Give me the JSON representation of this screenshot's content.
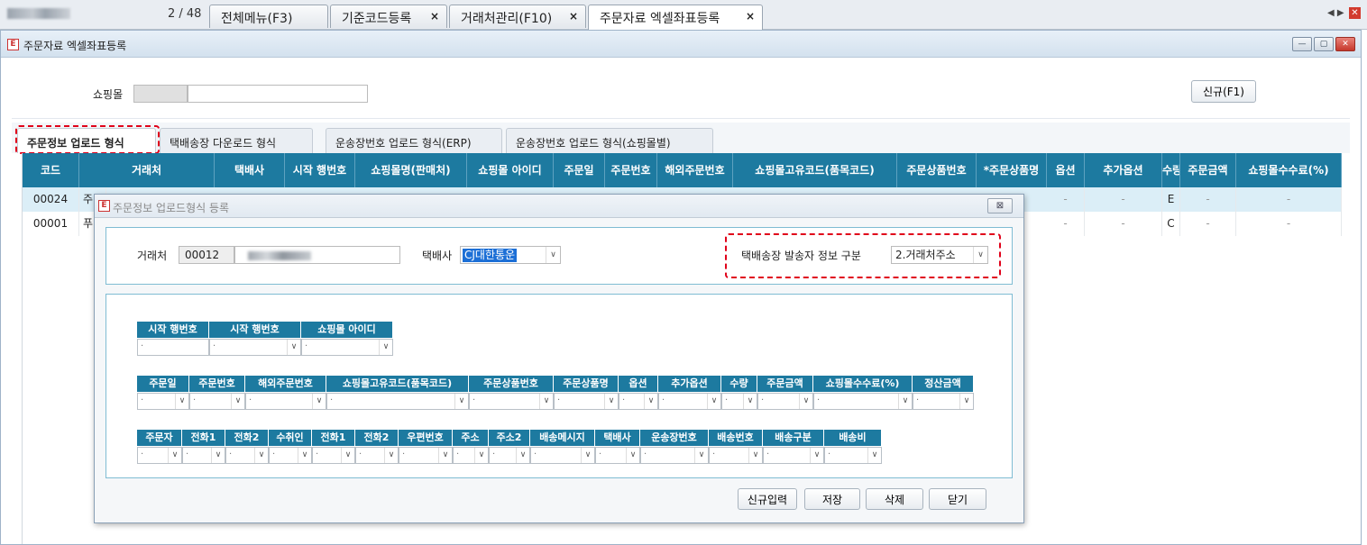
{
  "topbar": {
    "pager": "2 / 48",
    "tabs": [
      {
        "label": "전체메뉴(F3)",
        "closable": false
      },
      {
        "label": "기준코드등록",
        "closable": true
      },
      {
        "label": "거래처관리(F10)",
        "closable": true
      },
      {
        "label": "주문자료 엑셀좌표등록",
        "closable": true
      }
    ],
    "close_glyph": "×",
    "nav_arrows": "◀ ▶",
    "red_close": "✕"
  },
  "window": {
    "title": "주문자료 엑셀좌표등록",
    "icon": "app-logo-icon",
    "buttons": [
      "—",
      "▢",
      "✕"
    ]
  },
  "filter": {
    "shop_label": "쇼핑몰",
    "new_button": "신규(F1)"
  },
  "tabs": [
    {
      "label": "주문정보 업로드 형식",
      "active": true
    },
    {
      "label": "택배송장 다운로드 형식",
      "active": false
    },
    {
      "label": "운송장번호 업로드 형식(ERP)",
      "active": false
    },
    {
      "label": "운송장번호 업로드 형식(쇼핑몰별)",
      "active": false
    }
  ],
  "grid": {
    "columns": [
      "코드",
      "거래처",
      "택배사",
      "시작 행번호",
      "쇼핑몰명(판매처)",
      "쇼핑몰 아이디",
      "주문일",
      "주문번호",
      "해외주문번호",
      "쇼핑몰고유코드(품목코드)",
      "주문상품번호",
      "*주문상품명",
      "옵션",
      "추가옵션",
      "수량",
      "주문금액",
      "쇼핑몰수수료(%)"
    ],
    "rows": [
      {
        "code": "00024",
        "partner": "주",
        "option": "-",
        "extra_option": "-",
        "qty": "E",
        "amount": "-",
        "fee": "-"
      },
      {
        "code": "00001",
        "partner": "푸",
        "option": "-",
        "extra_option": "-",
        "qty": "C",
        "amount": "-",
        "fee": "-"
      }
    ]
  },
  "dialog": {
    "title": "주문정보 업로드형식 등록",
    "close_button": "⊠",
    "partner_label": "거래처",
    "partner_code": "00012",
    "courier_label": "택배사",
    "courier_value": "CJ대한통운",
    "sender_label": "택배송장 발송자 정보 구분",
    "sender_value": "2.거래처주소",
    "arrow_glyph": "∨",
    "row1_headers": [
      "시작 행번호",
      "시작 행번호",
      "쇼핑몰 아이디"
    ],
    "row2_headers": [
      "주문일",
      "주문번호",
      "해외주문번호",
      "쇼핑몰고유코드(품목코드)",
      "주문상품번호",
      "주문상품명",
      "옵션",
      "추가옵션",
      "수량",
      "주문금액",
      "쇼핑몰수수료(%)",
      "정산금액"
    ],
    "row3_headers": [
      "주문자",
      "전화1",
      "전화2",
      "수취인",
      "전화1",
      "전화2",
      "우편번호",
      "주소",
      "주소2",
      "배송메시지",
      "택배사",
      "운송장번호",
      "배송번호",
      "배송구분",
      "배송비"
    ],
    "cell_dot": "·",
    "buttons": [
      "신규입력",
      "저장",
      "삭제",
      "닫기"
    ]
  }
}
